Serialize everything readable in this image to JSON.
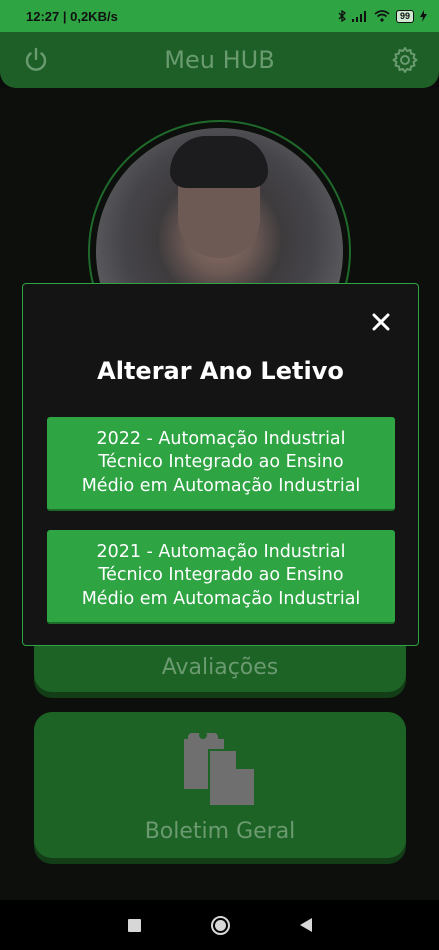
{
  "status_bar": {
    "time_and_speed": "12:27 | 0,2KB/s",
    "battery": "99"
  },
  "app_bar": {
    "title": "Meu HUB",
    "left_icon": "power-icon",
    "right_icon": "gear-icon"
  },
  "cards": {
    "avaliacoes_label": "Avaliações",
    "boletim_label": "Boletim Geral",
    "boletim_icon": "clipboard-copy-icon"
  },
  "modal": {
    "title": "Alterar Ano Letivo",
    "close_icon": "close-icon",
    "options": [
      {
        "line1": "2022 - Automação Industrial",
        "line2": "Técnico Integrado ao Ensino",
        "line3": "Médio em Automação Industrial"
      },
      {
        "line1": "2021 - Automação Industrial",
        "line2": "Técnico Integrado ao Ensino",
        "line3": "Médio em Automação Industrial"
      }
    ]
  },
  "colors": {
    "accent": "#2ea443",
    "dim_green": "#1d6325",
    "modal_bg": "#141414"
  }
}
